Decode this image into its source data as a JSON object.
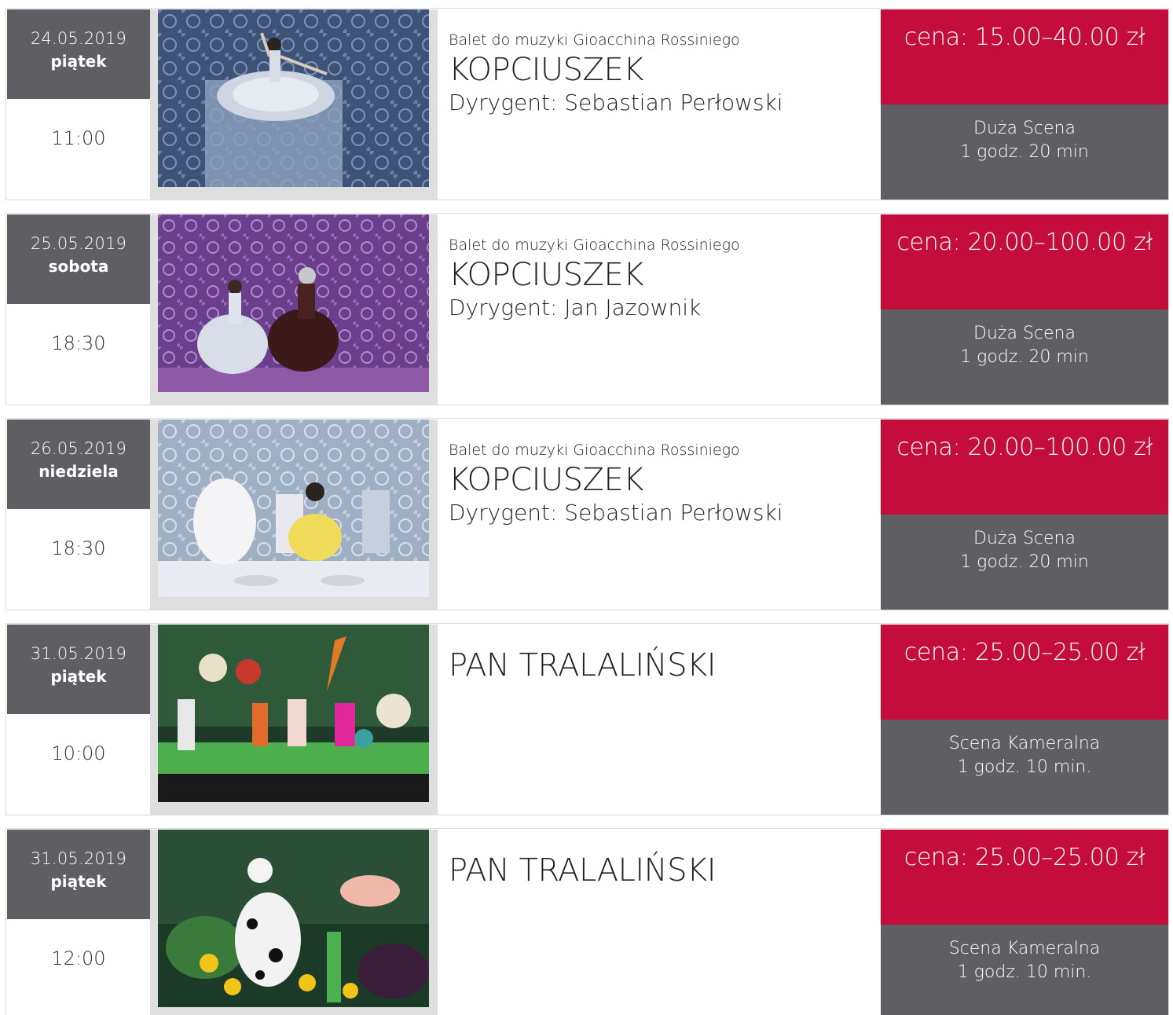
{
  "events": [
    {
      "date": "24.05.2019",
      "day": "piątek",
      "time": "11:00",
      "subtitle": "Balet do muzyki Gioacchina Rossiniego",
      "title": "KOPCIUSZEK",
      "conductor": "Dyrygent: Sebastian Perłowski",
      "price": "cena: 15.00–40.00 zł",
      "venue": "Duża Scena",
      "duration": "1 godz. 20 min",
      "photo_icon": "ballet-photo"
    },
    {
      "date": "25.05.2019",
      "day": "sobota",
      "time": "18:30",
      "subtitle": "Balet do muzyki Gioacchina Rossiniego",
      "title": "KOPCIUSZEK",
      "conductor": "Dyrygent: Jan Jazownik",
      "price": "cena: 20.00–100.00 zł",
      "venue": "Duża Scena",
      "duration": "1 godz. 20 min",
      "photo_icon": "ballet-photo"
    },
    {
      "date": "26.05.2019",
      "day": "niedziela",
      "time": "18:30",
      "subtitle": "Balet do muzyki Gioacchina Rossiniego",
      "title": "KOPCIUSZEK",
      "conductor": "Dyrygent: Sebastian Perłowski",
      "price": "cena: 20.00–100.00 zł",
      "venue": "Duża Scena",
      "duration": "1 godz. 20 min",
      "photo_icon": "ballet-photo"
    },
    {
      "date": "31.05.2019",
      "day": "piątek",
      "time": "10:00",
      "subtitle": "",
      "title": "PAN TRALALIŃSKI",
      "conductor": "",
      "price": "cena: 25.00–25.00 zł",
      "venue": "Scena Kameralna",
      "duration": "1 godz. 10 min.",
      "photo_icon": "theatre-photo"
    },
    {
      "date": "31.05.2019",
      "day": "piątek",
      "time": "12:00",
      "subtitle": "",
      "title": "PAN TRALALIŃSKI",
      "conductor": "",
      "price": "cena: 25.00–25.00 zł",
      "venue": "Scena Kameralna",
      "duration": "1 godz. 10 min.",
      "photo_icon": "theatre-photo"
    }
  ],
  "colors": {
    "accent_red": "#c40d3d",
    "dark_gray": "#5f5f63",
    "light_gray": "#dedede"
  }
}
